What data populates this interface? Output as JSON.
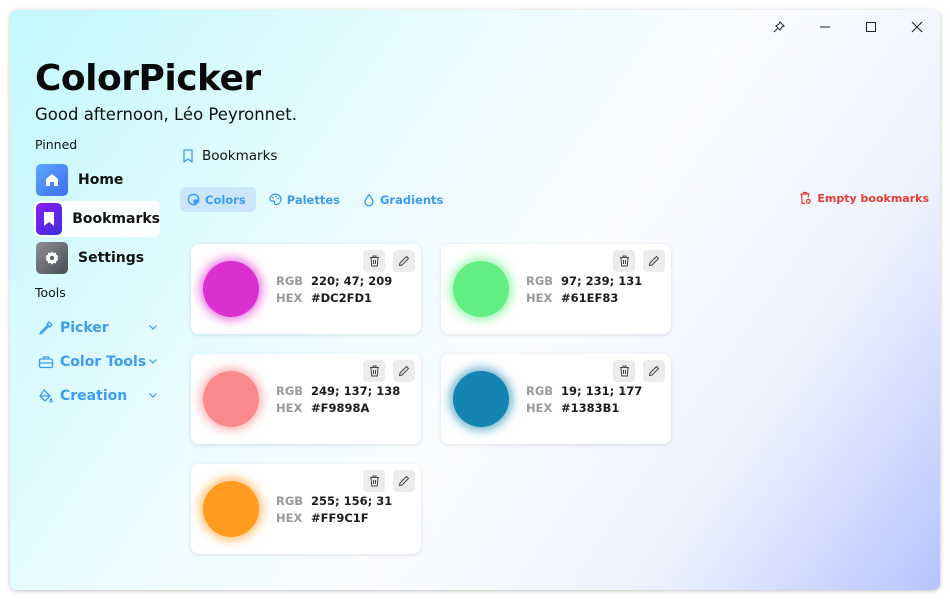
{
  "window": {
    "controls": {
      "pin": "pin-icon",
      "minimize": "minimize-icon",
      "maximize": "maximize-icon",
      "close": "close-icon"
    }
  },
  "header": {
    "title": "ColorPicker",
    "greeting": "Good afternoon, Léo Peyronnet."
  },
  "sidebar": {
    "pinned_label": "Pinned",
    "pinned": [
      {
        "label": "Home",
        "icon": "home-icon"
      },
      {
        "label": "Bookmarks",
        "icon": "bookmark-icon",
        "active": true
      },
      {
        "label": "Settings",
        "icon": "gear-icon"
      }
    ],
    "tools_label": "Tools",
    "tools": [
      {
        "label": "Picker",
        "icon": "eyedropper-icon"
      },
      {
        "label": "Color Tools",
        "icon": "toolbox-icon"
      },
      {
        "label": "Creation",
        "icon": "paint-bucket-icon"
      }
    ]
  },
  "main": {
    "heading": "Bookmarks",
    "tabs": [
      {
        "label": "Colors",
        "icon": "colors-icon",
        "active": true
      },
      {
        "label": "Palettes",
        "icon": "palette-icon"
      },
      {
        "label": "Gradients",
        "icon": "drop-icon"
      }
    ],
    "empty_label": "Empty bookmarks",
    "accent": "#3d9bf0",
    "danger": "#e53b30",
    "rgb_label": "RGB",
    "hex_label": "HEX",
    "colors": [
      {
        "rgb": "220; 47; 209",
        "hex": "#DC2FD1"
      },
      {
        "rgb": "97; 239; 131",
        "hex": "#61EF83"
      },
      {
        "rgb": "249; 137; 138",
        "hex": "#F9898A"
      },
      {
        "rgb": "19; 131; 177",
        "hex": "#1383B1"
      },
      {
        "rgb": "255; 156; 31",
        "hex": "#FF9C1F"
      }
    ]
  }
}
